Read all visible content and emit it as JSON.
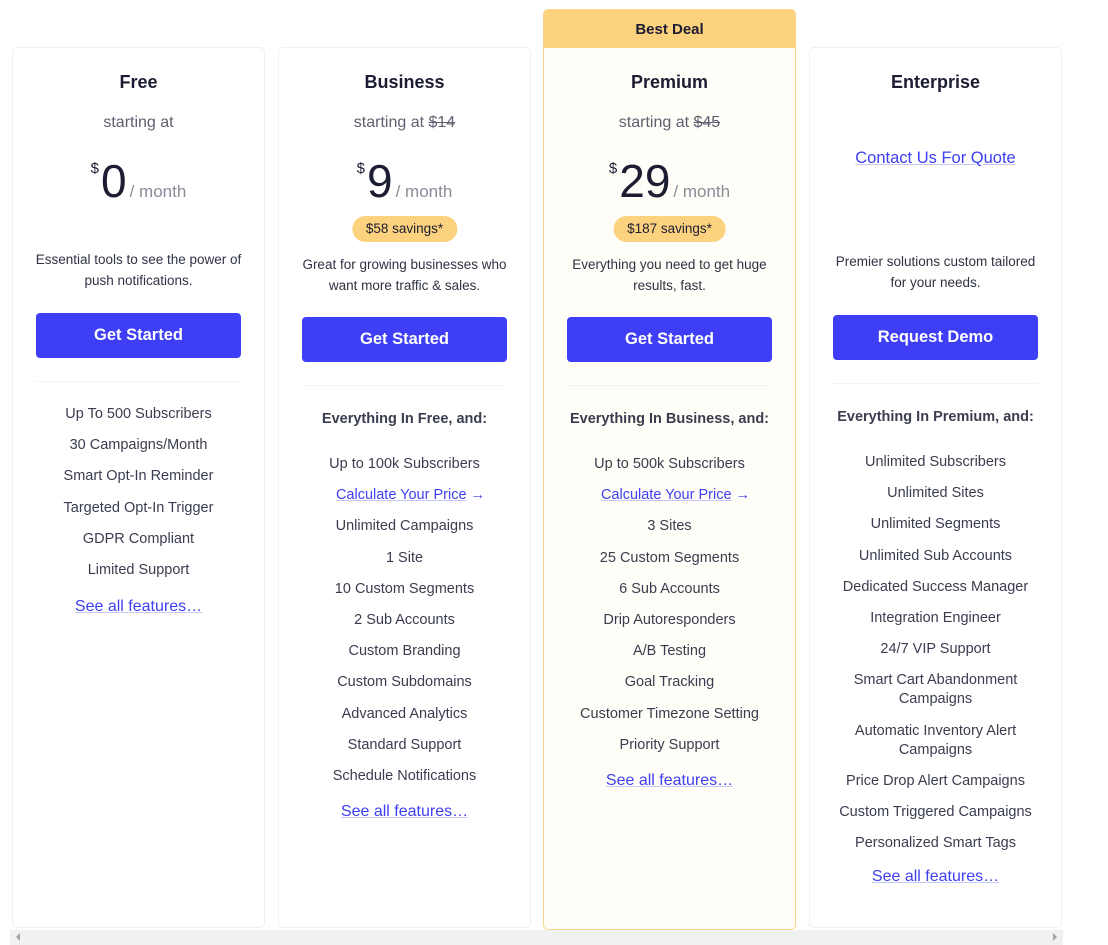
{
  "plans": [
    {
      "name": "Free",
      "starting_text": "starting at",
      "currency": "$",
      "price": "0",
      "period": "/ month",
      "description": "Essential tools to see the power of push notifications.",
      "cta": "Get Started",
      "features": [
        "Up To 500 Subscribers",
        "30 Campaigns/Month",
        "Smart Opt-In Reminder",
        "Targeted Opt-In Trigger",
        "GDPR Compliant",
        "Limited Support"
      ],
      "see_all": "See all features…"
    },
    {
      "name": "Business",
      "starting_text": "starting at",
      "original_price": "$14",
      "currency": "$",
      "price": "9",
      "period": "/ month",
      "savings": "$58 savings*",
      "description": "Great for growing businesses who want more traffic & sales.",
      "cta": "Get Started",
      "features_heading": "Everything In Free, and:",
      "features_first": "Up to 100k Subscribers",
      "calculate_link": "Calculate Your Price",
      "arrow": "→",
      "features": [
        "Unlimited Campaigns",
        "1 Site",
        "10 Custom Segments",
        "2 Sub Accounts",
        "Custom Branding",
        "Custom Subdomains",
        "Advanced Analytics",
        "Standard Support",
        "Schedule Notifications"
      ],
      "see_all": "See all features…"
    },
    {
      "name": "Premium",
      "ribbon": "Best Deal",
      "starting_text": "starting at",
      "original_price": "$45",
      "currency": "$",
      "price": "29",
      "period": "/ month",
      "savings": "$187 savings*",
      "description": "Everything you need to get huge results, fast.",
      "cta": "Get Started",
      "features_heading": "Everything In Business, and:",
      "features_first": "Up to 500k Subscribers",
      "calculate_link": "Calculate Your Price",
      "arrow": "→",
      "features": [
        "3 Sites",
        "25 Custom Segments",
        "6 Sub Accounts",
        "Drip Autoresponders",
        "A/B Testing",
        "Goal Tracking",
        "Customer Timezone Setting",
        "Priority Support"
      ],
      "see_all": "See all features…"
    },
    {
      "name": "Enterprise",
      "contact_link": "Contact Us For Quote",
      "description": "Premier solutions custom tailored for your needs.",
      "cta": "Request Demo",
      "features_heading": "Everything In Premium, and:",
      "features": [
        "Unlimited Subscribers",
        "Unlimited Sites",
        "Unlimited Segments",
        "Unlimited Sub Accounts",
        "Dedicated Success Manager",
        "Integration Engineer",
        "24/7 VIP Support",
        "Smart Cart Abandonment Campaigns",
        "Automatic Inventory Alert Campaigns",
        "Price Drop Alert Campaigns",
        "Custom Triggered Campaigns",
        "Personalized Smart Tags"
      ],
      "see_all": "See all features…"
    }
  ],
  "colors": {
    "button": "#3d3ef5",
    "badge": "#fcd27e",
    "link": "#3e3ff0",
    "premium_bg": "#fffdf7",
    "premium_border": "#f8d48a"
  },
  "scrollbar": {
    "left_icon": "scroll-left-arrow",
    "right_icon": "scroll-right-arrow"
  }
}
